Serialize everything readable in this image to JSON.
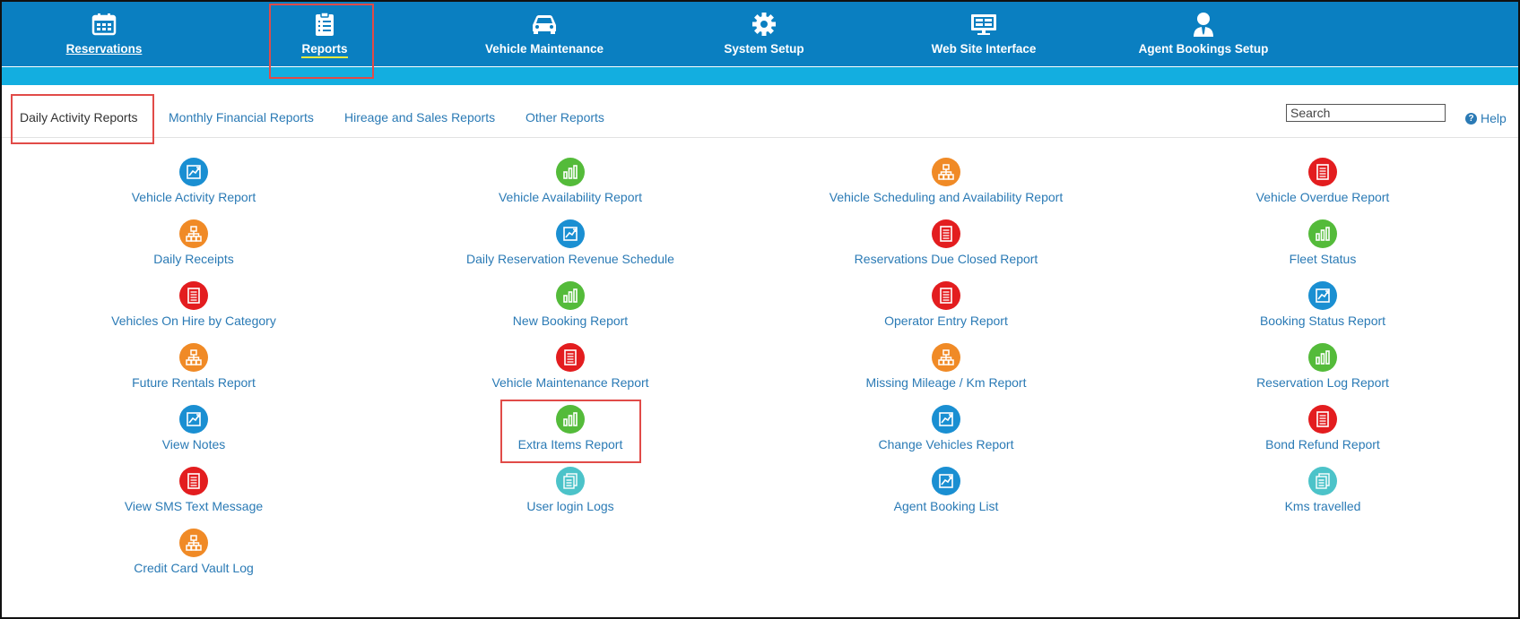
{
  "nav": [
    {
      "label": "Reservations",
      "icon": "calendar-icon"
    },
    {
      "label": "Reports",
      "icon": "checklist-icon"
    },
    {
      "label": "Vehicle Maintenance",
      "icon": "car-icon"
    },
    {
      "label": "System Setup",
      "icon": "gear-icon"
    },
    {
      "label": "Web Site Interface",
      "icon": "monitor-icon"
    },
    {
      "label": "Agent Bookings Setup",
      "icon": "user-icon"
    }
  ],
  "tabs": [
    "Daily Activity Reports",
    "Monthly Financial Reports",
    "Hireage and Sales Reports",
    "Other Reports"
  ],
  "search": {
    "placeholder": "Search"
  },
  "help": {
    "label": "Help"
  },
  "colors": {
    "nav_bg": "#0a7fc1",
    "subbar": "#13aee0",
    "link": "#2a7ab5",
    "highlight": "#e14b48",
    "blue": "#1a8fd2",
    "green": "#54bb3a",
    "orange": "#f08a26",
    "red": "#e31d1f",
    "teal": "#4cc3c9"
  },
  "reports": {
    "col1": [
      {
        "label": "Vehicle Activity Report",
        "icon": "trend-chart-icon"
      },
      {
        "label": "Daily Receipts",
        "icon": "hierarchy-icon"
      },
      {
        "label": "Vehicles On Hire by Category",
        "icon": "document-icon"
      },
      {
        "label": "Future Rentals Report",
        "icon": "hierarchy-icon"
      },
      {
        "label": "View Notes",
        "icon": "trend-chart-icon"
      },
      {
        "label": "View SMS Text Message",
        "icon": "document-icon"
      },
      {
        "label": "Credit Card Vault Log",
        "icon": "hierarchy-icon"
      }
    ],
    "col2": [
      {
        "label": "Vehicle Availability Report",
        "icon": "bar-chart-icon"
      },
      {
        "label": "Daily Reservation Revenue Schedule",
        "icon": "trend-chart-icon"
      },
      {
        "label": "New Booking Report",
        "icon": "bar-chart-icon"
      },
      {
        "label": "Vehicle Maintenance Report",
        "icon": "document-icon"
      },
      {
        "label": "Extra Items Report",
        "icon": "bar-chart-icon"
      },
      {
        "label": "User login Logs",
        "icon": "stacked-docs-icon"
      }
    ],
    "col3": [
      {
        "label": "Vehicle Scheduling and Availability Report",
        "icon": "hierarchy-icon"
      },
      {
        "label": "Reservations Due Closed Report",
        "icon": "document-icon"
      },
      {
        "label": "Operator Entry Report",
        "icon": "document-icon"
      },
      {
        "label": "Missing Mileage / Km Report",
        "icon": "hierarchy-icon"
      },
      {
        "label": "Change Vehicles Report",
        "icon": "trend-chart-icon"
      },
      {
        "label": "Agent Booking List",
        "icon": "trend-chart-icon"
      }
    ],
    "col4": [
      {
        "label": "Vehicle Overdue Report",
        "icon": "document-icon"
      },
      {
        "label": "Fleet Status",
        "icon": "bar-chart-icon"
      },
      {
        "label": "Booking Status Report",
        "icon": "trend-chart-icon"
      },
      {
        "label": "Reservation Log Report",
        "icon": "bar-chart-icon"
      },
      {
        "label": "Bond Refund Report",
        "icon": "document-icon"
      },
      {
        "label": "Kms travelled",
        "icon": "stacked-docs-icon"
      }
    ]
  }
}
